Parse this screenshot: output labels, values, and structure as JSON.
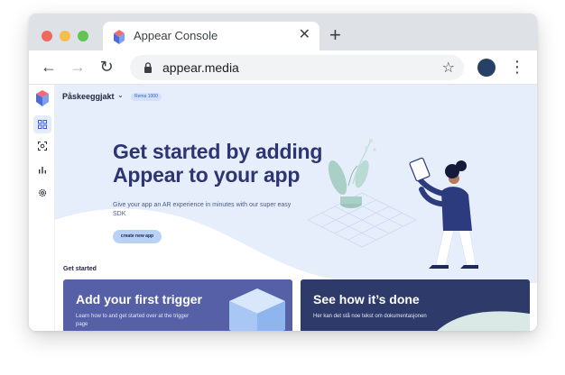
{
  "browser": {
    "tab_title": "Appear Console",
    "tab_close_glyph": "✕",
    "new_tab_glyph": "+",
    "url": "appear.media",
    "back_glyph": "←",
    "forward_glyph": "→",
    "reload_glyph": "↻",
    "star_glyph": "☆",
    "menu_glyph": "⋮"
  },
  "sidebar": {
    "items": [
      {
        "icon": "dashboard-grid-icon",
        "active": true
      },
      {
        "icon": "ar-scan-icon",
        "active": false
      },
      {
        "icon": "analytics-bars-icon",
        "active": false
      },
      {
        "icon": "settings-gear-icon",
        "active": false
      }
    ]
  },
  "header": {
    "project_name": "Påskeeggjakt",
    "project_chevron": "⌄",
    "org_badge": "Rema 1000"
  },
  "hero": {
    "title_line1": "Get started by adding",
    "title_line2": "Appear to your app",
    "subtitle": "Give your app an AR experience in minutes with our super easy SDK",
    "cta_label": "create new app"
  },
  "get_started": {
    "section_label": "Get started",
    "cards": [
      {
        "title": "Add your first trigger",
        "description": "Learn how to and get started over at the trigger page"
      },
      {
        "title": "See how it’s done",
        "description": "Her kan det stå noe tekst om dokumentasjonen"
      }
    ]
  },
  "colors": {
    "hero_background": "#e6eefb",
    "title_color": "#2d3572",
    "card_trigger": "#5560a6",
    "card_docs": "#2d3a6a",
    "profile_avatar": "#274067"
  }
}
